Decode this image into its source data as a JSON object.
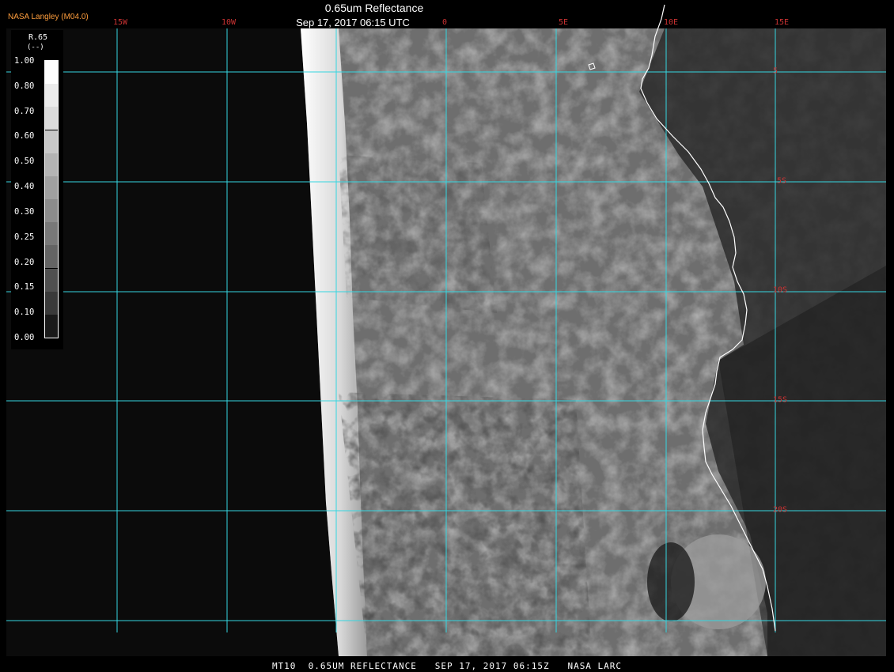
{
  "header": {
    "product_label": "NASA Langley (M04.0)",
    "title": "0.65um Reflectance",
    "subtitle": "Sep 17, 2017 06:15 UTC"
  },
  "grid": {
    "longitude_labels": [
      "15W",
      "10W",
      "0",
      "5E",
      "10E",
      "15E"
    ],
    "latitude_labels": [
      "5",
      "5S",
      "10S",
      "15S",
      "20S"
    ]
  },
  "legend": {
    "title": "R.65",
    "unit": "(--)",
    "ticks": [
      "1.00",
      "0.80",
      "0.70",
      "0.60",
      "0.50",
      "0.40",
      "0.30",
      "0.25",
      "0.20",
      "0.15",
      "0.10",
      "0.00"
    ],
    "colors": [
      "#ffffff",
      "#ececec",
      "#dcdcdc",
      "#c8c8c8",
      "#b4b4b4",
      "#a0a0a0",
      "#8c8c8c",
      "#787878",
      "#646464",
      "#505050",
      "#3a3a3a",
      "#1a1a1a"
    ]
  },
  "colors": {
    "grid_line": "#35d6e0",
    "coastline": "#ffffff",
    "label_red": "#cc3333",
    "label_orange": "#ff9e3d"
  },
  "footer": {
    "caption": "MT10  0.65UM REFLECTANCE   SEP 17, 2017 06:15Z   NASA LARC"
  }
}
